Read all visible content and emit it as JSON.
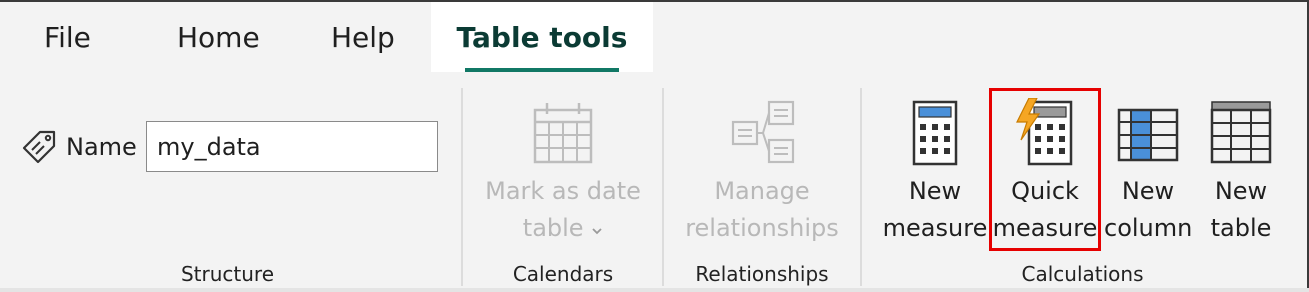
{
  "tabs": [
    {
      "label": "File"
    },
    {
      "label": "Home"
    },
    {
      "label": "Help"
    },
    {
      "label": "Table tools"
    }
  ],
  "structure": {
    "name_label": "Name",
    "name_value": "my_data",
    "group_label": "Structure"
  },
  "calendars": {
    "button_line1": "Mark as date",
    "button_line2": "table",
    "dropdown_icon": "chevron-down-icon",
    "group_label": "Calendars"
  },
  "relationships": {
    "button_line1": "Manage",
    "button_line2": "relationships",
    "group_label": "Relationships"
  },
  "calculations": {
    "group_label": "Calculations",
    "buttons": [
      {
        "line1": "New",
        "line2": "measure",
        "icon": "calculator-icon"
      },
      {
        "line1": "Quick",
        "line2": "measure",
        "icon": "quick-measure-icon"
      },
      {
        "line1": "New",
        "line2": "column",
        "icon": "new-column-icon"
      },
      {
        "line1": "New",
        "line2": "table",
        "icon": "new-table-icon"
      }
    ]
  },
  "colors": {
    "accent": "#117865",
    "highlight": "#e60000",
    "disabled_text": "#b8b8b8",
    "icon_blue": "#4a90d9",
    "lightning": "#f5a623"
  }
}
